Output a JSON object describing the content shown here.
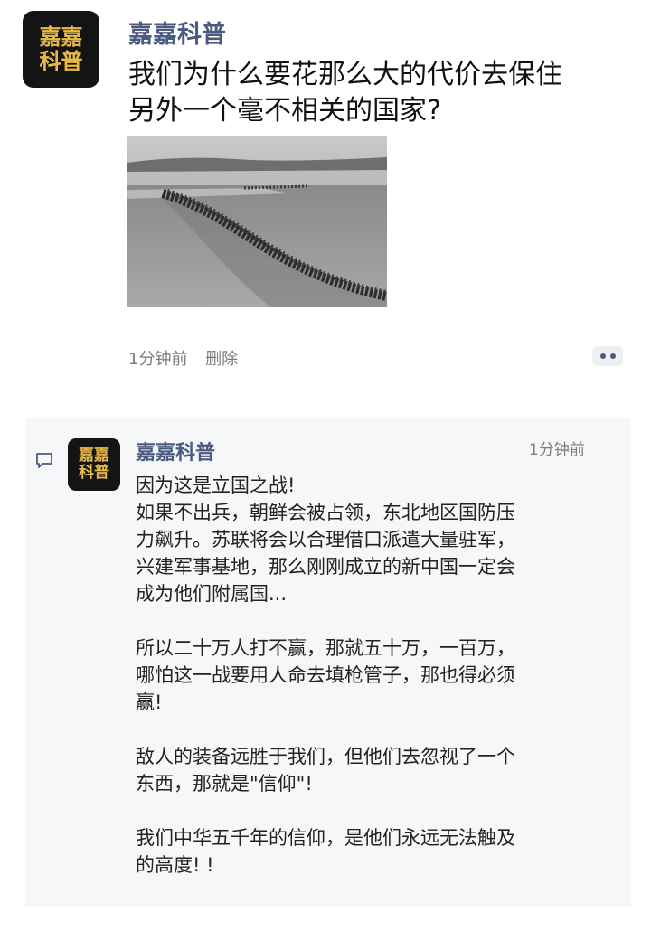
{
  "post": {
    "avatar_line1": "嘉嘉",
    "avatar_line2": "科普",
    "author": "嘉嘉科普",
    "text_line1": "我们为什么要花那么大的代价去保住",
    "text_line2": "另外一个毫不相关的国家?",
    "time": "1分钟前",
    "delete_label": "删除",
    "more_icon": "more-icon"
  },
  "comment": {
    "avatar_line1": "嘉嘉",
    "avatar_line2": "科普",
    "author": "嘉嘉科普",
    "time": "1分钟前",
    "icon": "comment-icon",
    "lines": [
      "因为这是立国之战!",
      "如果不出兵，朝鲜会被占领，东北地区国防压",
      "力飙升。苏联将会以合理借口派遣大量驻军，",
      "兴建军事基地，那么刚刚成立的新中国一定会",
      "成为他们附属国...",
      "",
      "所以二十万人打不赢，那就五十万，一百万，",
      "哪怕这一战要用人命去填枪管子，那也得必须",
      "赢!",
      "",
      "敌人的装备远胜于我们，但他们去忽视了一个",
      "东西，那就是\"信仰\"!",
      "",
      "我们中华五千年的信仰，是他们永远无法触及",
      "的高度! !"
    ]
  },
  "colors": {
    "author": "#4a5a80",
    "avatar_bg": "#141414",
    "avatar_text": "#e8b94a",
    "meta": "#7c7c7c",
    "comment_bg": "#f6f7f9"
  }
}
